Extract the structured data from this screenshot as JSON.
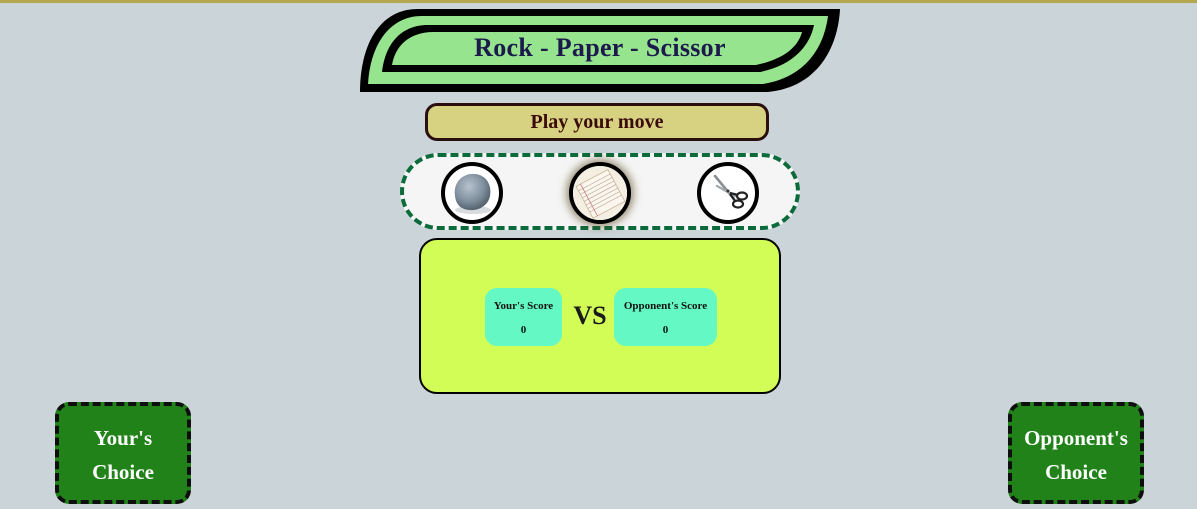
{
  "app": {
    "title": "Rock - Paper - Scissor",
    "prompt": "Play your move"
  },
  "choices": [
    {
      "id": "rock",
      "icon": "rock-icon",
      "selected": false
    },
    {
      "id": "paper",
      "icon": "paper-icon",
      "selected": true
    },
    {
      "id": "scissors",
      "icon": "scissors-icon",
      "selected": false
    }
  ],
  "score": {
    "you_label": "Your's Score",
    "you_value": "0",
    "vs": "VS",
    "opp_label": "Opponent's Score",
    "opp_value": "0"
  },
  "tiles": {
    "you_line1": "Your's",
    "you_line2": "Choice",
    "opp_line1": "Opponent's",
    "opp_line2": "Choice"
  },
  "colors": {
    "background": "#cbd4d8",
    "title_fill": "#97e48f",
    "prompt_bg": "#d6d282",
    "score_panel": "#d2fc56",
    "score_box": "#63f8c4",
    "tile_bg": "#218219",
    "choices_border": "#0b6b3b"
  }
}
